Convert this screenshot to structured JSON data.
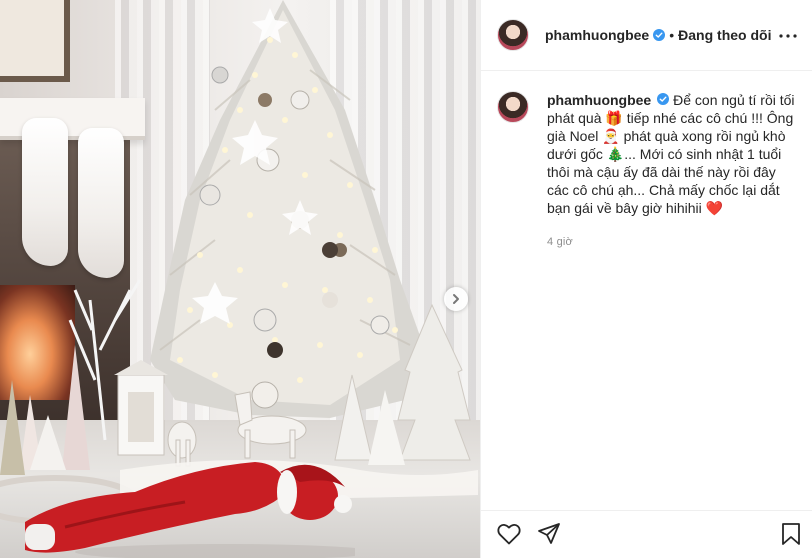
{
  "post": {
    "username": "phamhuongbee",
    "verified": true,
    "separator": "•",
    "follow_status": "Đang theo dõi",
    "caption_text": "Để con ngủ tí rồi tối phát quà 🎁 tiếp nhé các cô chú !!! Ông già Noel 🎅 phát quà xong rồi ngủ khò dưới gốc 🎄... Mới có sinh nhật 1 tuổi thôi mà cậu ấy đã dài thế này rồi đây các cô chú ạh... Chả mấy chốc lại dắt bạn gái về bây giờ hihihii ❤️",
    "timestamp": "4 giờ"
  },
  "icons": {
    "verified": "verified-badge-icon",
    "more": "more-options-icon",
    "next": "chevron-right-icon",
    "like": "heart-icon",
    "share": "paper-plane-icon",
    "save": "bookmark-icon"
  },
  "colors": {
    "verified_blue": "#3897f0",
    "text": "#262626",
    "muted": "#8e8e8e",
    "border": "#efefef"
  }
}
